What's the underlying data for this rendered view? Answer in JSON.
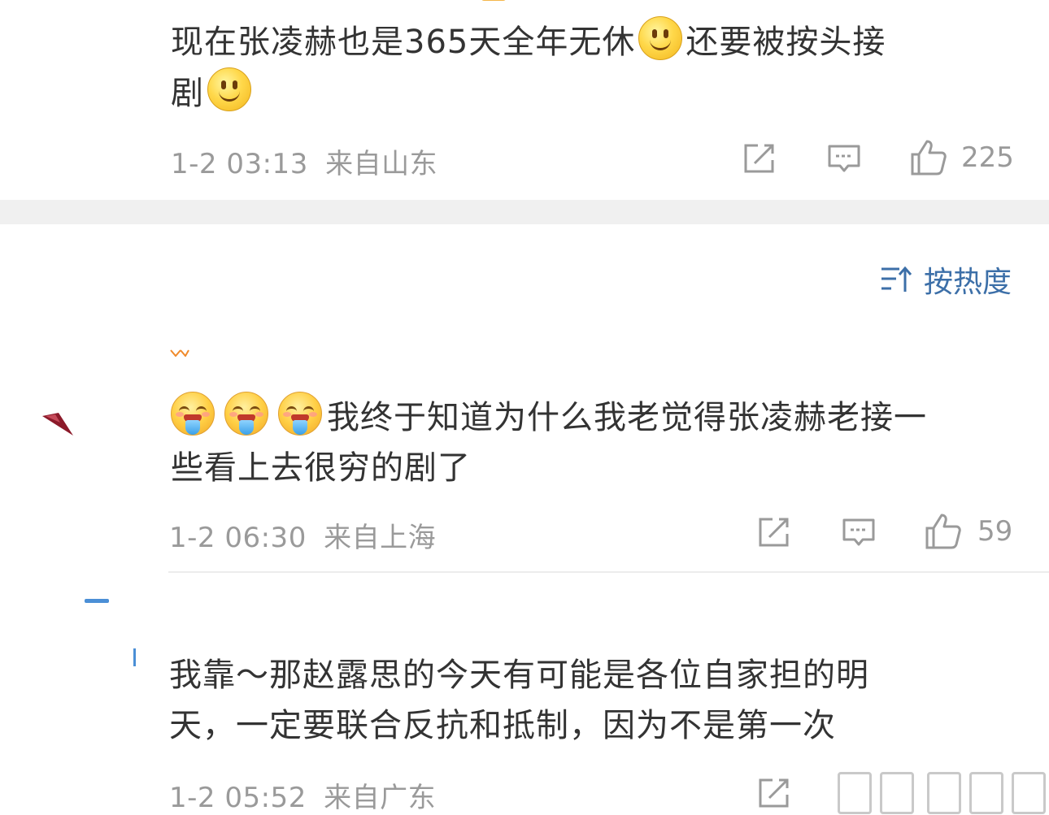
{
  "comments": [
    {
      "text_part1": "现在张凌赫也是365天全年无休",
      "text_part2": "还要被按头接",
      "text_line2": "剧",
      "time": "1-2 03:13",
      "location": "来自山东",
      "likes": "225"
    },
    {
      "text_line1": "我终于知道为什么我老觉得张凌赫老接一",
      "text_line2": "些看上去很穷的剧了",
      "time": "1-2 06:30",
      "location": "来自上海",
      "likes": "59"
    },
    {
      "text_line1": "我靠～那赵露思的今天有可能是各位自家担的明",
      "text_line2": "天，一定要联合反抗和抵制，因为不是第一次",
      "time": "1-2 05:52",
      "location": "来自广东"
    }
  ],
  "sort": {
    "label": "按热度"
  },
  "icons": [
    "share-icon",
    "reply-icon",
    "like-icon",
    "sort-icon",
    "smile-emoji",
    "drool-emoji"
  ],
  "colors": {
    "sort_accent": "#3c6fa8",
    "meta_gray": "#9a9a9a",
    "text": "#333333",
    "band": "#f0f0f0"
  }
}
